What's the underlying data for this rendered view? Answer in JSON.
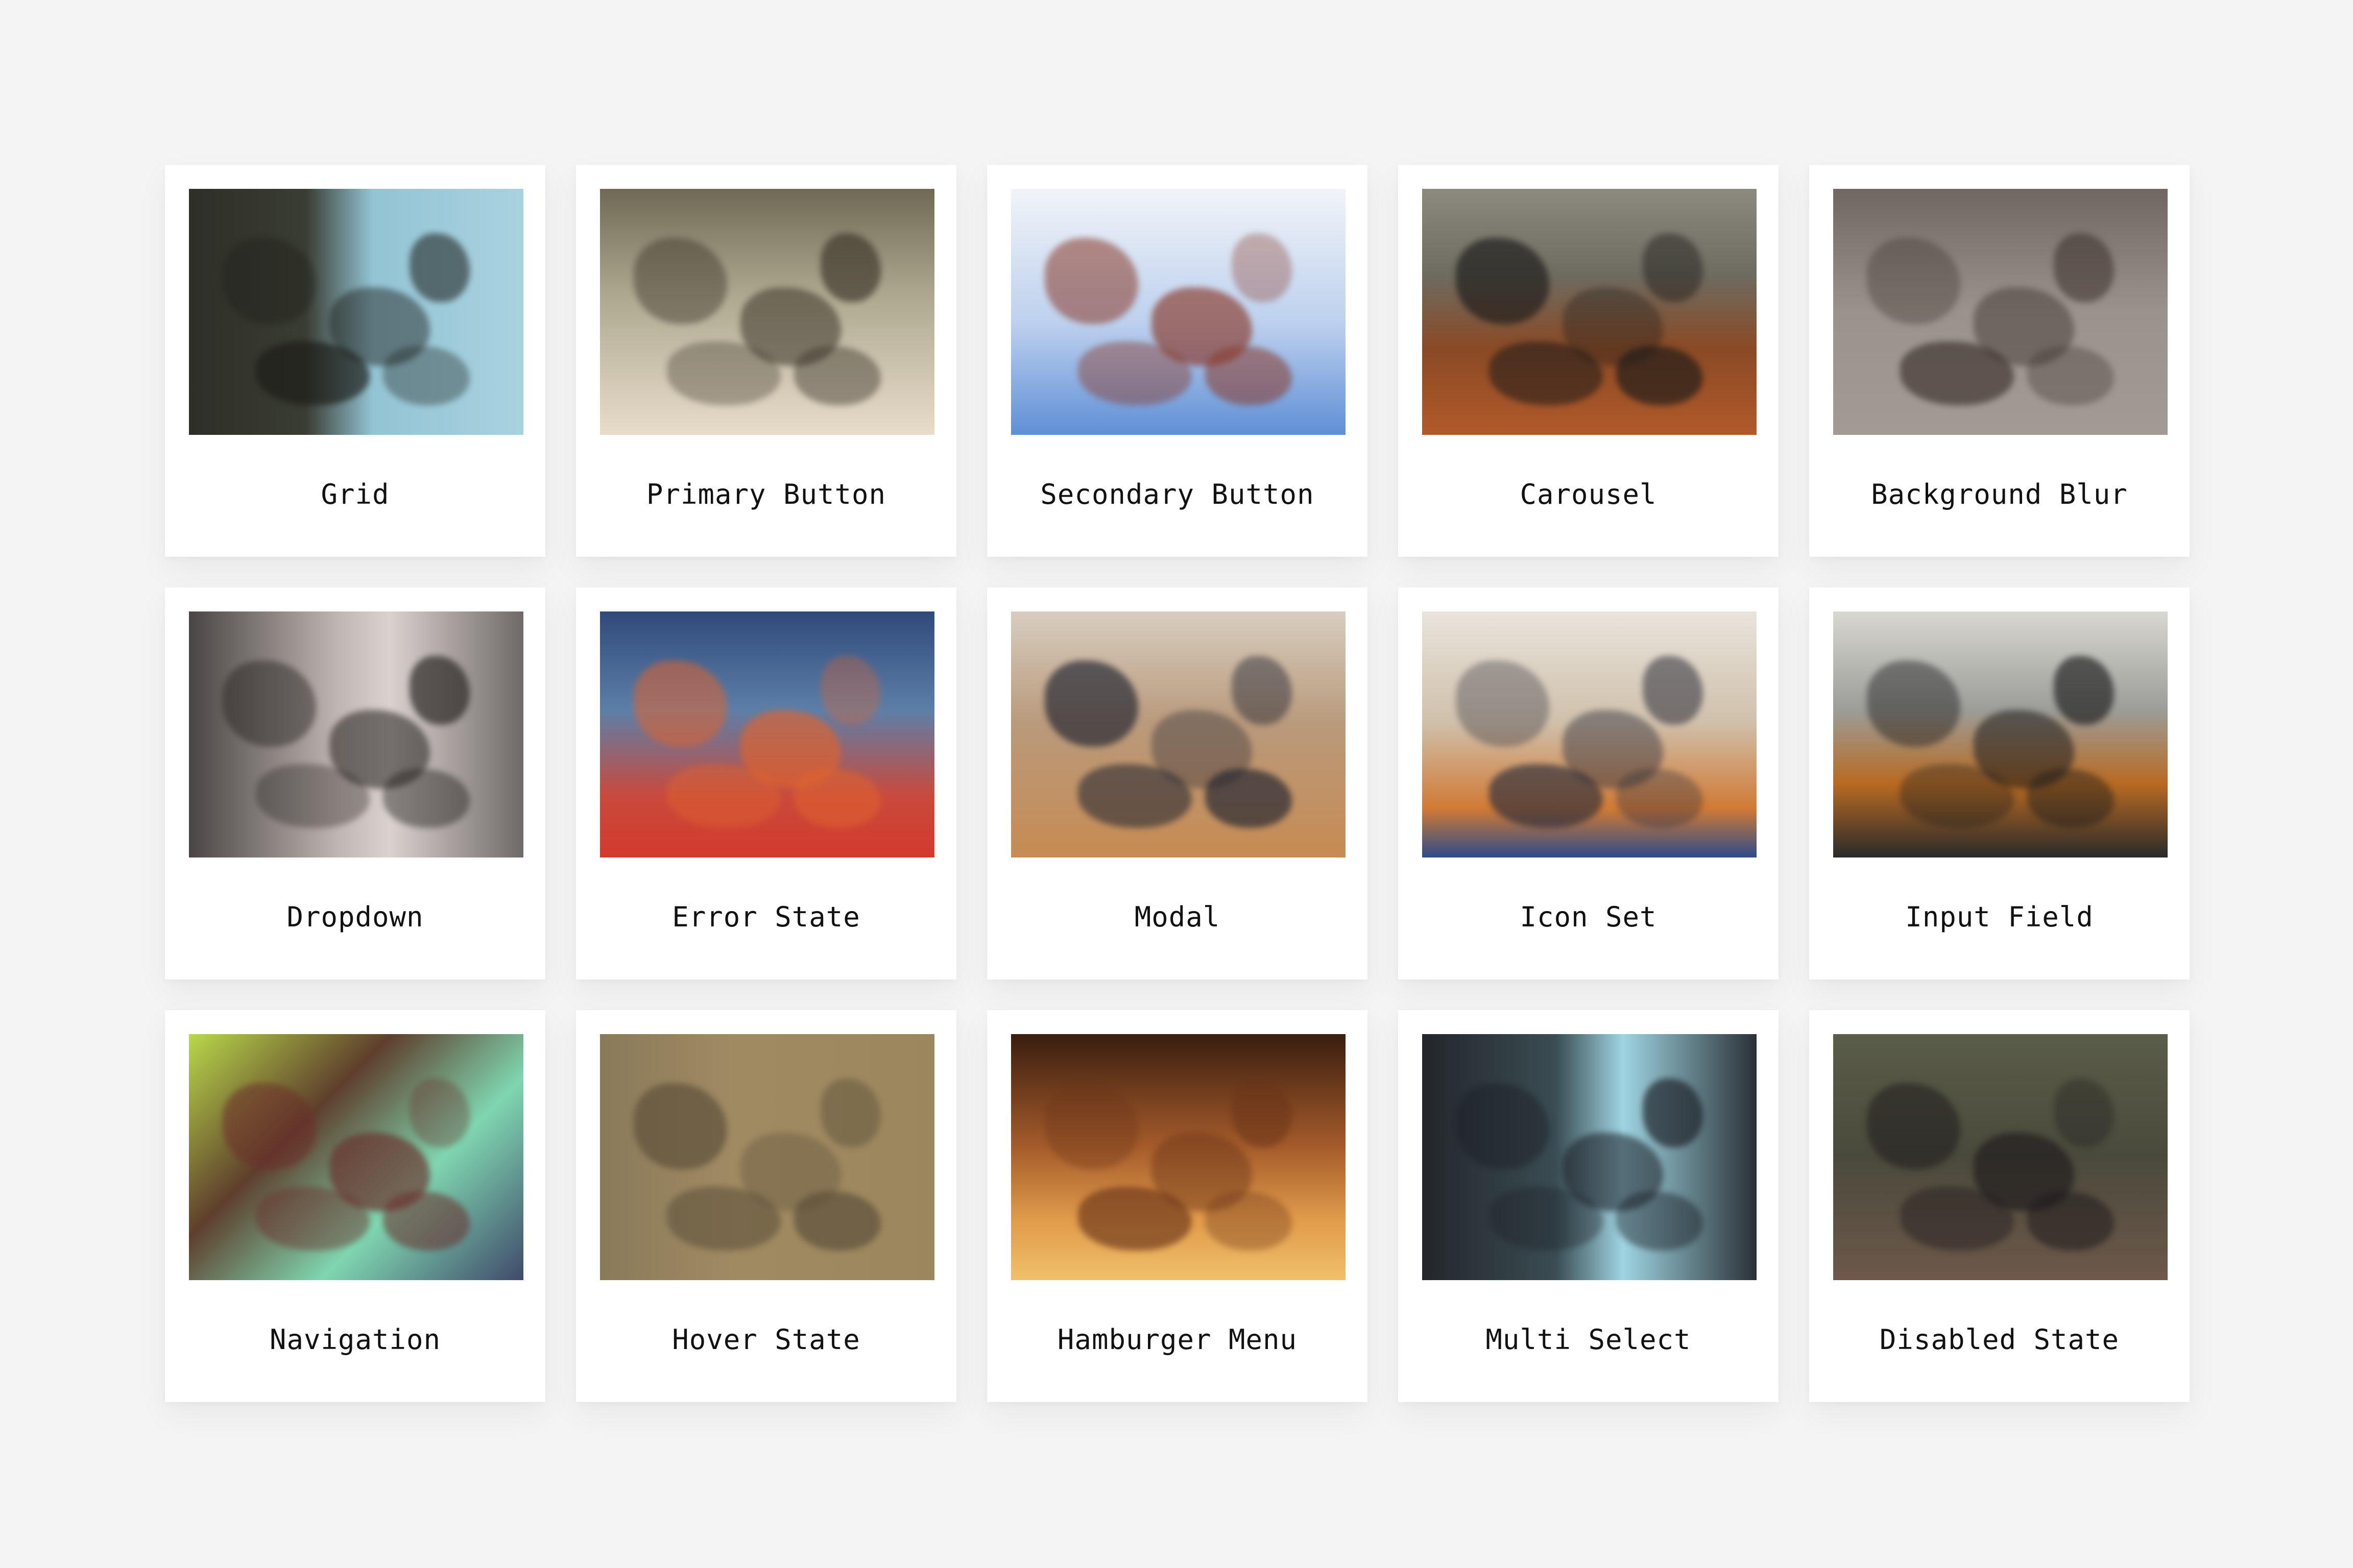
{
  "cards": [
    {
      "label": "Grid",
      "bg": "linear-gradient(90deg,#2e2f28 0%,#3a3d33 35%,#93c4d4 55%,#a9d2e0 100%)",
      "accent": "#1a1b16"
    },
    {
      "label": "Primary Button",
      "bg": "linear-gradient(180deg,#6e6a55 0%,#b0aa92 45%,#e8dccb 100%)",
      "accent": "#3b3429"
    },
    {
      "label": "Secondary Button",
      "bg": "linear-gradient(180deg,#f1f4f8 0%,#bcd0ee 55%,#5f8fd6 100%)",
      "accent": "#8a3a2a"
    },
    {
      "label": "Carousel",
      "bg": "linear-gradient(180deg,#8c8a7f 0%,#6e6b60 35%,#8a4a25 65%,#b25a2a 100%)",
      "accent": "#1b1a19"
    },
    {
      "label": "Background Blur",
      "bg": "linear-gradient(180deg,#6f6760 0%,#9a928c 50%,#a29a95 100%)",
      "accent": "#3c302c"
    },
    {
      "label": "Dropdown",
      "bg": "linear-gradient(90deg,#4a4544 0%,#bfb7b3 45%,#d9d2cf 60%,#6f6967 100%)",
      "accent": "#241f1d"
    },
    {
      "label": "Error State",
      "bg": "linear-gradient(180deg,#304a7a 0%,#5c7fa8 40%,#c94a3c 75%,#d33a2c 100%)",
      "accent": "#e0632e"
    },
    {
      "label": "Modal",
      "bg": "linear-gradient(180deg,#d8cdbf 0%,#b99a7c 45%,#c78b52 100%)",
      "accent": "#1e2230"
    },
    {
      "label": "Icon Set",
      "bg": "linear-gradient(180deg,#e9e4dc 0%,#cfc0ab 45%,#d17a35 80%,#2d4c8a 100%)",
      "accent": "#2c2d3a"
    },
    {
      "label": "Input Field",
      "bg": "linear-gradient(180deg,#d8d7d2 0%,#9c9d98 40%,#b86a22 70%,#2a2a2a 100%)",
      "accent": "#1c1c1c"
    },
    {
      "label": "Navigation",
      "bg": "linear-gradient(135deg,#b9d94a 0%,#5e3f2c 35%,#7fd6b0 65%,#3f4a6a 100%)",
      "accent": "#6b2d2a"
    },
    {
      "label": "Hover State",
      "bg": "linear-gradient(90deg,#8a7a5a 0%,#a08a62 40%,#9b875d 100%)",
      "accent": "#5a4d39"
    },
    {
      "label": "Hamburger Menu",
      "bg": "linear-gradient(180deg,#3a1e10 0%,#a35a2a 45%,#e09a4a 75%,#f0c06a 100%)",
      "accent": "#6a3519"
    },
    {
      "label": "Multi Select",
      "bg": "linear-gradient(90deg,#23262a 0%,#3a4d53 40%,#9fd4e2 60%,#2a3136 100%)",
      "accent": "#1b1d24"
    },
    {
      "label": "Disabled State",
      "bg": "linear-gradient(180deg,#5a5d48 0%,#4a4a3c 50%,#6e584a 100%)",
      "accent": "#1f1b1d"
    }
  ]
}
